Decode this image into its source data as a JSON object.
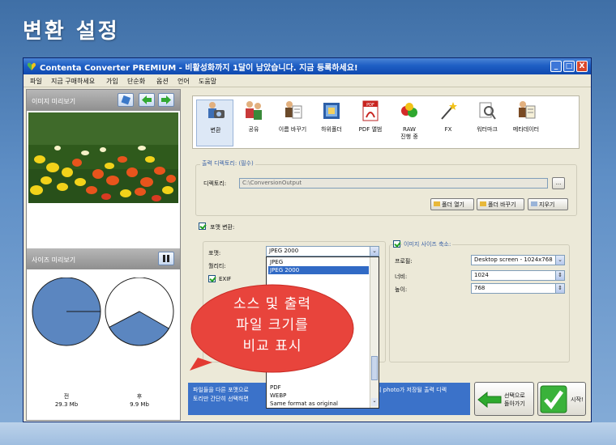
{
  "slide_title": "변환 설정",
  "window": {
    "title": "Contenta Converter PREMIUM - 비활성화까지 1달이 남았습니다. 지금 등록하세요!",
    "controls": {
      "minimize": "_",
      "maximize": "□",
      "close": "X"
    }
  },
  "menu": [
    "파일",
    "지금 구매하세요",
    "가입",
    "단순화",
    "옵션",
    "언어",
    "도움말"
  ],
  "left_panel": {
    "image_preview_label": "이미지 미리보기",
    "size_preview_label": "사이즈 미리보기",
    "before_label": "전",
    "before_size": "29.3 Mb",
    "after_label": "후",
    "after_size": "9.9 Mb",
    "after_fraction": 0.34
  },
  "toolbar": {
    "items": [
      {
        "label": "변환",
        "icon": "camera-icon"
      },
      {
        "label": "공유",
        "icon": "people-icon"
      },
      {
        "label": "이름 바꾸기",
        "icon": "rename-icon"
      },
      {
        "label": "하위폴더",
        "icon": "folder-icon"
      },
      {
        "label": "PDF 앨범",
        "icon": "pdf-icon"
      },
      {
        "label": "RAW\n진행 중",
        "icon": "raw-icon"
      },
      {
        "label": "FX",
        "icon": "fx-wand-icon"
      },
      {
        "label": "워터마크",
        "icon": "watermark-icon"
      },
      {
        "label": "메타데이터",
        "icon": "metadata-icon"
      }
    ]
  },
  "output_dir": {
    "section_title": "출력 디렉토리: (필수)",
    "label": "디렉토리:",
    "value": "C:\\ConversionOutput",
    "browse_label": "...",
    "open_folder": "폴더 열기",
    "change_folder": "폴더 바꾸기",
    "clear": "지우기"
  },
  "format_convert": {
    "checkbox_label": "포맷 변환:",
    "format_label": "포맷:",
    "format_value": "JPEG 2000",
    "quality_label": "퀄리티:",
    "exif_label": "EXIF",
    "options": [
      "JPEG",
      "JPEG 2000",
      "PDF",
      "WEBP",
      "Same format as original"
    ],
    "selected_index": 1
  },
  "resize": {
    "checkbox_label": "이미지 사이즈 축소:",
    "profile_label": "프로필:",
    "profile_value": "Desktop screen - 1024x768",
    "width_label": "너비:",
    "width_value": "1024",
    "height_label": "높이:",
    "height_value": "768"
  },
  "hint_text": "파일들을 다른 포맷으로 ... 의 photo가 저장될 출력 디렉토리만 간단히 선택하면 ...",
  "hint_left_1": "파일들을 다른 포맷으로",
  "hint_right_1": "의 photo가 저장될 출력 디렉",
  "hint_left_2": "토리만 간단히 선택하면",
  "back_button": "선택으로\n돌아가기",
  "start_button": "시작!",
  "callout_text": [
    "소스 및 출력",
    "파일 크기를",
    "비교 표시"
  ],
  "colors": {
    "titlebar": "#1f5fc4",
    "pie_fill": "#5b86c0",
    "callout": "#ee4a42",
    "selection": "#316ac5",
    "hint_bg": "#3b72c9"
  }
}
